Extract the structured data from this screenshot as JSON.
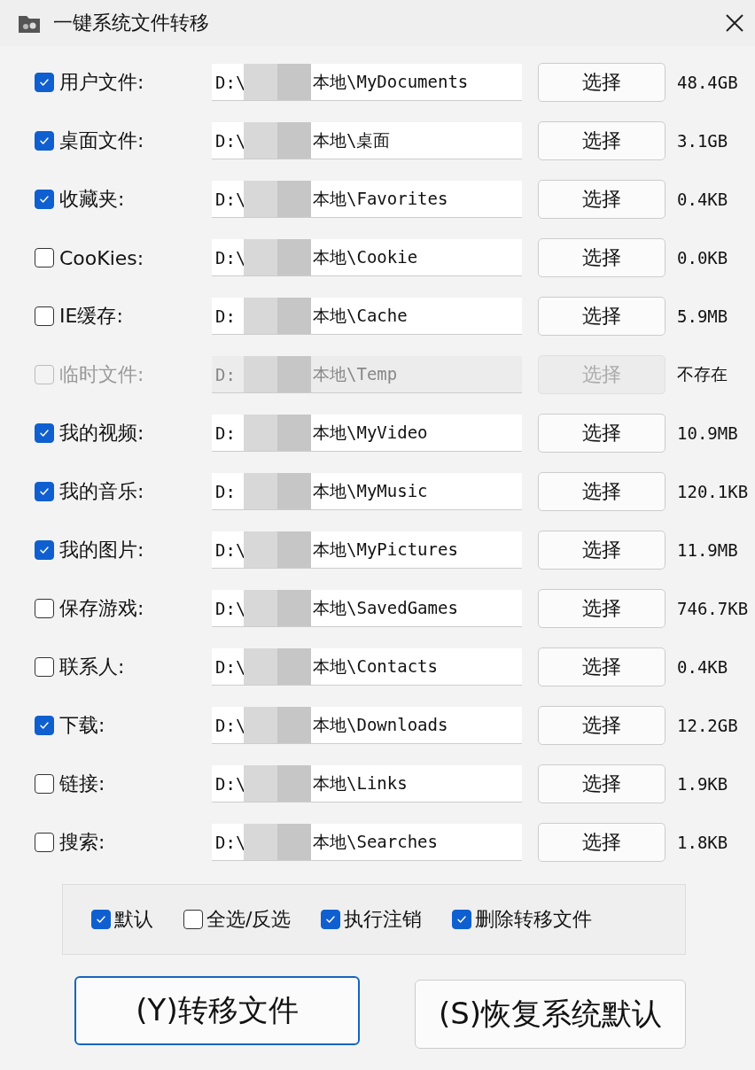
{
  "window": {
    "title": "一键系统文件转移"
  },
  "folders": [
    {
      "label": "用户文件:",
      "checked": true,
      "disabled": false,
      "path_prefix": "D:\\",
      "path_suffix": "本地\\MyDocuments",
      "button": "选择",
      "size": "48.4GB"
    },
    {
      "label": "桌面文件:",
      "checked": true,
      "disabled": false,
      "path_prefix": "D:\\",
      "path_suffix": "本地\\桌面",
      "button": "选择",
      "size": "3.1GB"
    },
    {
      "label": "收藏夹:",
      "checked": true,
      "disabled": false,
      "path_prefix": "D:\\",
      "path_suffix": "本地\\Favorites",
      "button": "选择",
      "size": "0.4KB"
    },
    {
      "label": "CooKies:",
      "checked": false,
      "disabled": false,
      "path_prefix": "D:\\",
      "path_suffix": "本地\\Cookie",
      "button": "选择",
      "size": "0.0KB"
    },
    {
      "label": "IE缓存:",
      "checked": false,
      "disabled": false,
      "path_prefix": "D:",
      "path_suffix": "本地\\Cache",
      "button": "选择",
      "size": "5.9MB"
    },
    {
      "label": "临时文件:",
      "checked": false,
      "disabled": true,
      "path_prefix": "D:",
      "path_suffix": "本地\\Temp",
      "button": "选择",
      "size": "不存在"
    },
    {
      "label": "我的视频:",
      "checked": true,
      "disabled": false,
      "path_prefix": "D:",
      "path_suffix": "本地\\MyVideo",
      "button": "选择",
      "size": "10.9MB"
    },
    {
      "label": "我的音乐:",
      "checked": true,
      "disabled": false,
      "path_prefix": "D:",
      "path_suffix": "本地\\MyMusic",
      "button": "选择",
      "size": "120.1KB"
    },
    {
      "label": "我的图片:",
      "checked": true,
      "disabled": false,
      "path_prefix": "D:\\",
      "path_suffix": "本地\\MyPictures",
      "button": "选择",
      "size": "11.9MB"
    },
    {
      "label": "保存游戏:",
      "checked": false,
      "disabled": false,
      "path_prefix": "D:\\",
      "path_suffix": "本地\\SavedGames",
      "button": "选择",
      "size": "746.7KB"
    },
    {
      "label": "联系人:",
      "checked": false,
      "disabled": false,
      "path_prefix": "D:\\",
      "path_suffix": "本地\\Contacts",
      "button": "选择",
      "size": "0.4KB"
    },
    {
      "label": "下载:",
      "checked": true,
      "disabled": false,
      "path_prefix": "D:\\",
      "path_suffix": "本地\\Downloads",
      "button": "选择",
      "size": "12.2GB"
    },
    {
      "label": "链接:",
      "checked": false,
      "disabled": false,
      "path_prefix": "D:\\",
      "path_suffix": "本地\\Links",
      "button": "选择",
      "size": "1.9KB"
    },
    {
      "label": "搜索:",
      "checked": false,
      "disabled": false,
      "path_prefix": "D:\\",
      "path_suffix": "本地\\Searches",
      "button": "选择",
      "size": "1.8KB"
    }
  ],
  "options": [
    {
      "label": "默认",
      "checked": true
    },
    {
      "label": "全选/反选",
      "checked": false
    },
    {
      "label": "执行注销",
      "checked": true
    },
    {
      "label": "删除转移文件",
      "checked": true
    }
  ],
  "buttons": [
    {
      "label": "(Y)转移文件",
      "selected": true
    },
    {
      "label": "(S)恢复系统默认",
      "selected": false
    }
  ]
}
